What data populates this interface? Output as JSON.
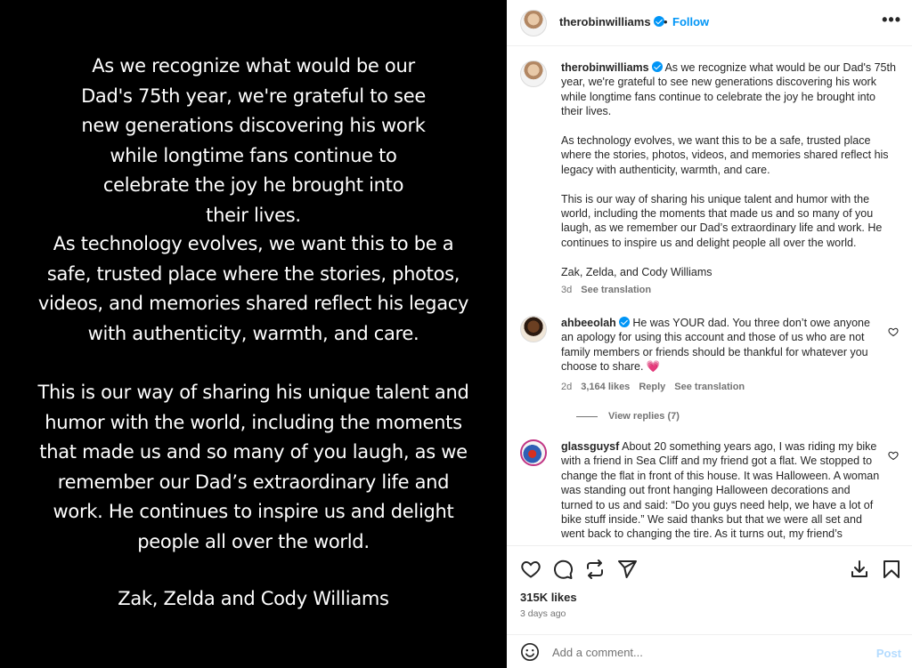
{
  "media": {
    "p1": "As we recognize what would be our Dad's 75th year, we're grateful to see new generations discovering his work while longtime fans continue to celebrate the joy he brought into their lives.",
    "p2": "As technology evolves, we want this to be a safe, trusted place where the stories, photos, videos, and memories shared reflect his legacy with authenticity, warmth, and care.",
    "p3": "This is our way of sharing his unique talent and humor with the world, including the moments that made us and so many of you laugh, as we remember our Dad’s extraordinary life and work. He continues to inspire us and delight people all over the world.",
    "p4": "Zak, Zelda and Cody Williams"
  },
  "header": {
    "username": "therobinwilliams",
    "dot": "•",
    "follow": "Follow",
    "more": "•••"
  },
  "caption": {
    "username": "therobinwilliams",
    "p1": "As we recognize what would be our Dad's 75th year, we're grateful to see new generations discovering his work while longtime fans continue to celebrate the joy he brought into their lives.",
    "p2": "As technology evolves, we want this to be a safe, trusted place where the stories, photos, videos, and memories shared reflect his legacy with authenticity, warmth, and care.",
    "p3": "This is our way of sharing his unique talent and humor with the world, including the moments that made us and so many of you laugh, as we remember our Dad’s extraordinary life and work. He continues to inspire us and delight people all over the world.",
    "p4": "Zak, Zelda, and Cody Williams",
    "time": "3d",
    "translate": "See translation"
  },
  "comments": [
    {
      "username": "ahbeeolah",
      "verified": true,
      "text": "He was YOUR dad. You three don’t owe anyone an apology for using this account and those of us who are not family members or friends should be thankful for whatever you choose to share.",
      "emoji": "💗",
      "time": "2d",
      "likes": "3,164 likes",
      "reply": "Reply",
      "translate": "See translation",
      "view_replies": "View replies (7)"
    },
    {
      "username": "glassguysf",
      "verified": false,
      "text": "About 20 something years ago, I was riding my bike with a friend in Sea Cliff and my friend got a flat. We stopped to change the flat in front of this house. It was Halloween. A woman was standing out front hanging Halloween decorations and turned to us and said: “Do you guys need help, we have a lot of bike stuff inside.” We said thanks but that we were all set and went back to changing the tire. As it turns out, my friend’s"
    }
  ],
  "actions": {
    "icons": [
      "heart-icon",
      "comment-icon",
      "repost-icon",
      "share-icon",
      "download-icon",
      "bookmark-icon"
    ]
  },
  "stats": {
    "likes": "315K likes",
    "ago": "3 days ago"
  },
  "add_comment": {
    "placeholder": "Add a comment...",
    "post": "Post"
  },
  "colors": {
    "accent": "#0095f6",
    "secondary_text": "#737373",
    "heart_emoji": "#e84a7a"
  }
}
